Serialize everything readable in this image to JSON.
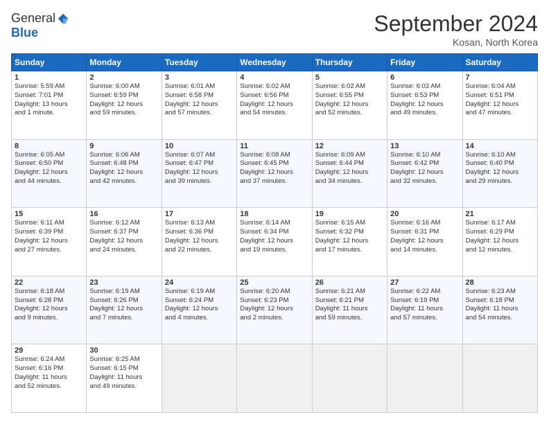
{
  "header": {
    "logo_general": "General",
    "logo_blue": "Blue",
    "month_title": "September 2024",
    "location": "Kosan, North Korea"
  },
  "weekdays": [
    "Sunday",
    "Monday",
    "Tuesday",
    "Wednesday",
    "Thursday",
    "Friday",
    "Saturday"
  ],
  "weeks": [
    [
      {
        "day": "1",
        "info": "Sunrise: 5:59 AM\nSunset: 7:01 PM\nDaylight: 13 hours\nand 1 minute."
      },
      {
        "day": "2",
        "info": "Sunrise: 6:00 AM\nSunset: 6:59 PM\nDaylight: 12 hours\nand 59 minutes."
      },
      {
        "day": "3",
        "info": "Sunrise: 6:01 AM\nSunset: 6:58 PM\nDaylight: 12 hours\nand 57 minutes."
      },
      {
        "day": "4",
        "info": "Sunrise: 6:02 AM\nSunset: 6:56 PM\nDaylight: 12 hours\nand 54 minutes."
      },
      {
        "day": "5",
        "info": "Sunrise: 6:02 AM\nSunset: 6:55 PM\nDaylight: 12 hours\nand 52 minutes."
      },
      {
        "day": "6",
        "info": "Sunrise: 6:03 AM\nSunset: 6:53 PM\nDaylight: 12 hours\nand 49 minutes."
      },
      {
        "day": "7",
        "info": "Sunrise: 6:04 AM\nSunset: 6:51 PM\nDaylight: 12 hours\nand 47 minutes."
      }
    ],
    [
      {
        "day": "8",
        "info": "Sunrise: 6:05 AM\nSunset: 6:50 PM\nDaylight: 12 hours\nand 44 minutes."
      },
      {
        "day": "9",
        "info": "Sunrise: 6:06 AM\nSunset: 6:48 PM\nDaylight: 12 hours\nand 42 minutes."
      },
      {
        "day": "10",
        "info": "Sunrise: 6:07 AM\nSunset: 6:47 PM\nDaylight: 12 hours\nand 39 minutes."
      },
      {
        "day": "11",
        "info": "Sunrise: 6:08 AM\nSunset: 6:45 PM\nDaylight: 12 hours\nand 37 minutes."
      },
      {
        "day": "12",
        "info": "Sunrise: 6:09 AM\nSunset: 6:44 PM\nDaylight: 12 hours\nand 34 minutes."
      },
      {
        "day": "13",
        "info": "Sunrise: 6:10 AM\nSunset: 6:42 PM\nDaylight: 12 hours\nand 32 minutes."
      },
      {
        "day": "14",
        "info": "Sunrise: 6:10 AM\nSunset: 6:40 PM\nDaylight: 12 hours\nand 29 minutes."
      }
    ],
    [
      {
        "day": "15",
        "info": "Sunrise: 6:11 AM\nSunset: 6:39 PM\nDaylight: 12 hours\nand 27 minutes."
      },
      {
        "day": "16",
        "info": "Sunrise: 6:12 AM\nSunset: 6:37 PM\nDaylight: 12 hours\nand 24 minutes."
      },
      {
        "day": "17",
        "info": "Sunrise: 6:13 AM\nSunset: 6:36 PM\nDaylight: 12 hours\nand 22 minutes."
      },
      {
        "day": "18",
        "info": "Sunrise: 6:14 AM\nSunset: 6:34 PM\nDaylight: 12 hours\nand 19 minutes."
      },
      {
        "day": "19",
        "info": "Sunrise: 6:15 AM\nSunset: 6:32 PM\nDaylight: 12 hours\nand 17 minutes."
      },
      {
        "day": "20",
        "info": "Sunrise: 6:16 AM\nSunset: 6:31 PM\nDaylight: 12 hours\nand 14 minutes."
      },
      {
        "day": "21",
        "info": "Sunrise: 6:17 AM\nSunset: 6:29 PM\nDaylight: 12 hours\nand 12 minutes."
      }
    ],
    [
      {
        "day": "22",
        "info": "Sunrise: 6:18 AM\nSunset: 6:28 PM\nDaylight: 12 hours\nand 9 minutes."
      },
      {
        "day": "23",
        "info": "Sunrise: 6:19 AM\nSunset: 6:26 PM\nDaylight: 12 hours\nand 7 minutes."
      },
      {
        "day": "24",
        "info": "Sunrise: 6:19 AM\nSunset: 6:24 PM\nDaylight: 12 hours\nand 4 minutes."
      },
      {
        "day": "25",
        "info": "Sunrise: 6:20 AM\nSunset: 6:23 PM\nDaylight: 12 hours\nand 2 minutes."
      },
      {
        "day": "26",
        "info": "Sunrise: 6:21 AM\nSunset: 6:21 PM\nDaylight: 11 hours\nand 59 minutes."
      },
      {
        "day": "27",
        "info": "Sunrise: 6:22 AM\nSunset: 6:19 PM\nDaylight: 11 hours\nand 57 minutes."
      },
      {
        "day": "28",
        "info": "Sunrise: 6:23 AM\nSunset: 6:18 PM\nDaylight: 11 hours\nand 54 minutes."
      }
    ],
    [
      {
        "day": "29",
        "info": "Sunrise: 6:24 AM\nSunset: 6:16 PM\nDaylight: 11 hours\nand 52 minutes."
      },
      {
        "day": "30",
        "info": "Sunrise: 6:25 AM\nSunset: 6:15 PM\nDaylight: 11 hours\nand 49 minutes."
      },
      {
        "day": "",
        "info": ""
      },
      {
        "day": "",
        "info": ""
      },
      {
        "day": "",
        "info": ""
      },
      {
        "day": "",
        "info": ""
      },
      {
        "day": "",
        "info": ""
      }
    ]
  ]
}
